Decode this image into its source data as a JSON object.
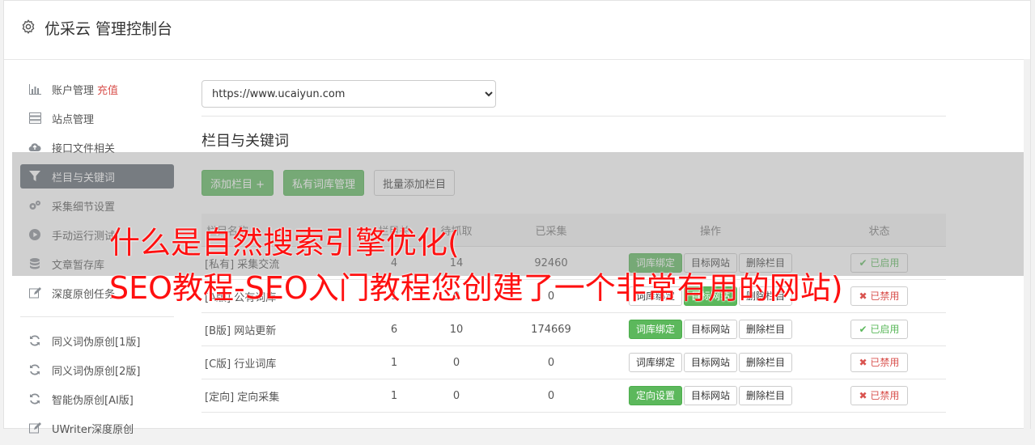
{
  "header": {
    "title": "优采云 管理控制台"
  },
  "sidebar": {
    "items": [
      {
        "label": "账户管理",
        "extra": "充值",
        "icon": "bar-chart-icon"
      },
      {
        "label": "站点管理",
        "icon": "server-icon"
      },
      {
        "label": "接口文件相关",
        "icon": "cloud-upload-icon"
      },
      {
        "label": "栏目与关键词",
        "icon": "filter-icon",
        "active": true
      },
      {
        "label": "采集细节设置",
        "icon": "cogs-icon"
      },
      {
        "label": "手动运行测试",
        "icon": "play-icon"
      },
      {
        "label": "文章暂存库",
        "icon": "database-icon"
      },
      {
        "label": "深度原创任务",
        "icon": "edit-icon"
      }
    ],
    "items2": [
      {
        "label": "同义词伪原创[1版]",
        "icon": "refresh-icon"
      },
      {
        "label": "同义词伪原创[2版]",
        "icon": "refresh-icon"
      },
      {
        "label": "智能伪原创[AI版]",
        "icon": "refresh-icon"
      },
      {
        "label": "UWriter深度原创",
        "icon": "edit-icon"
      }
    ]
  },
  "main": {
    "site_select": "https://www.ucaiyun.com",
    "section_title": "栏目与关键词",
    "buttons": {
      "add_column": "添加栏目 +",
      "private_lib": "私有词库管理",
      "batch_add": "批量添加栏目"
    },
    "table": {
      "headers": [
        "栏目名称",
        "栏目关",
        "待抓取",
        "已采集",
        "操作",
        "状态"
      ],
      "rows": [
        {
          "tag": "[私有]",
          "name": "采集交流",
          "a": "4",
          "b": "14",
          "c": "92460",
          "op1": "词库绑定",
          "op2": "目标网站",
          "op3": "删除栏目",
          "status": "已启用"
        },
        {
          "tag": "[A版]",
          "name": "公有词库",
          "a": "1",
          "b": "0",
          "c": "0",
          "op1": "词库绑定",
          "op2": "目标网站",
          "op3": "删除栏目",
          "status": "已禁用"
        },
        {
          "tag": "[B版]",
          "name": "网站更新",
          "a": "6",
          "b": "10",
          "c": "174669",
          "op1": "词库绑定",
          "op2": "目标网站",
          "op3": "删除栏目",
          "status": "已启用"
        },
        {
          "tag": "[C版]",
          "name": "行业词库",
          "a": "1",
          "b": "0",
          "c": "0",
          "op1": "词库绑定",
          "op2": "目标网站",
          "op3": "删除栏目",
          "status": "已禁用"
        },
        {
          "tag": "[定向]",
          "name": "定向采集",
          "a": "1",
          "b": "0",
          "c": "0",
          "op1": "定向设置",
          "op2": "目标网站",
          "op3": "删除栏目",
          "status": "已禁用"
        }
      ]
    }
  },
  "watermark": {
    "line1": "什么是自然搜索引擎优化(",
    "line2": "SEO教程-SEO入门教程您创建了一个非常有用的网站)"
  },
  "colors": {
    "accent_green": "#5cb85c",
    "sidebar_active": "#5e6670",
    "danger": "#d9534f",
    "watermark": "#ff1010"
  }
}
